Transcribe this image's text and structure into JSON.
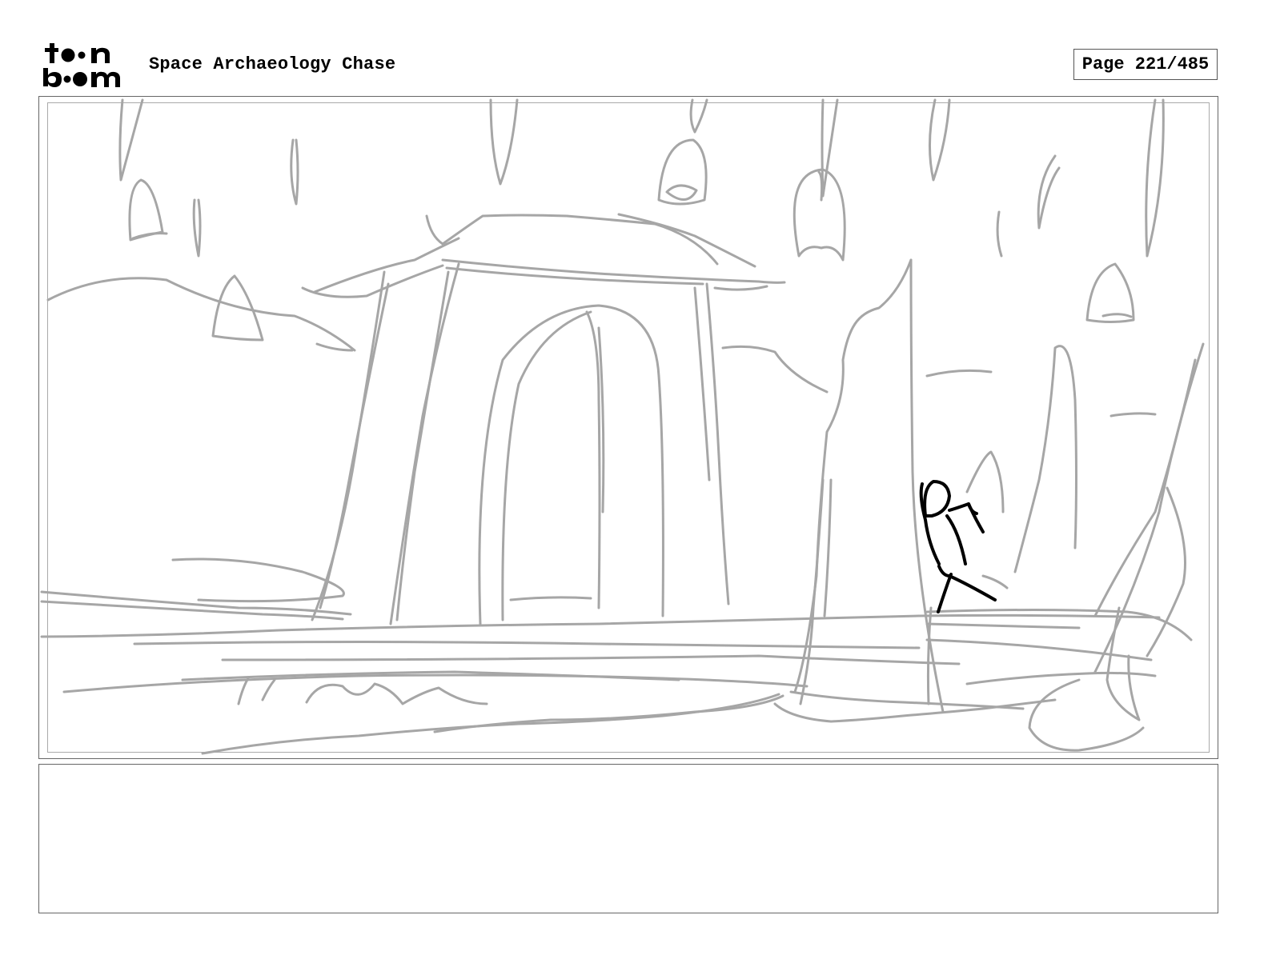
{
  "header": {
    "logo_text": "toon boom",
    "project_title": "Space Archaeology Chase",
    "page_label": "Page 221/485"
  },
  "panel": {
    "sketch_color": "#a6a6a6",
    "figure_color": "#000000"
  },
  "notes": {
    "text": ""
  }
}
